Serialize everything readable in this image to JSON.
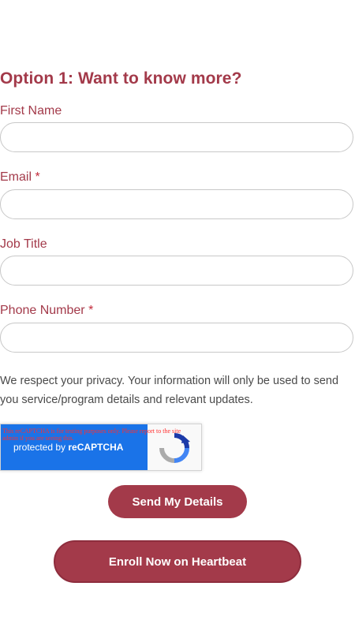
{
  "form": {
    "heading": "Option 1: Want to know more?",
    "fields": [
      {
        "label": "First Name",
        "required": "",
        "value": "",
        "placeholder": ""
      },
      {
        "label": "Email",
        "required": "*",
        "value": "",
        "placeholder": ""
      },
      {
        "label": "Job Title",
        "required": "",
        "value": "",
        "placeholder": ""
      },
      {
        "label": "Phone Number",
        "required": "*",
        "value": "",
        "placeholder": ""
      }
    ],
    "privacy_note": "We respect your privacy. Your information will only be used to send you service/program details and relevant updates.",
    "submit_label": "Send My Details"
  },
  "recaptcha": {
    "warning": "This reCAPTCHA is for testing purposes only. Please report to the site admin if you are seeing this.",
    "protected_by": "protected by",
    "brand": "reCAPTCHA"
  },
  "enroll": {
    "label": "Enroll Now on Heartbeat"
  },
  "colors": {
    "accent": "#a33a4a",
    "required": "#c22b3b",
    "recaptcha_blue": "#1a73e8"
  }
}
